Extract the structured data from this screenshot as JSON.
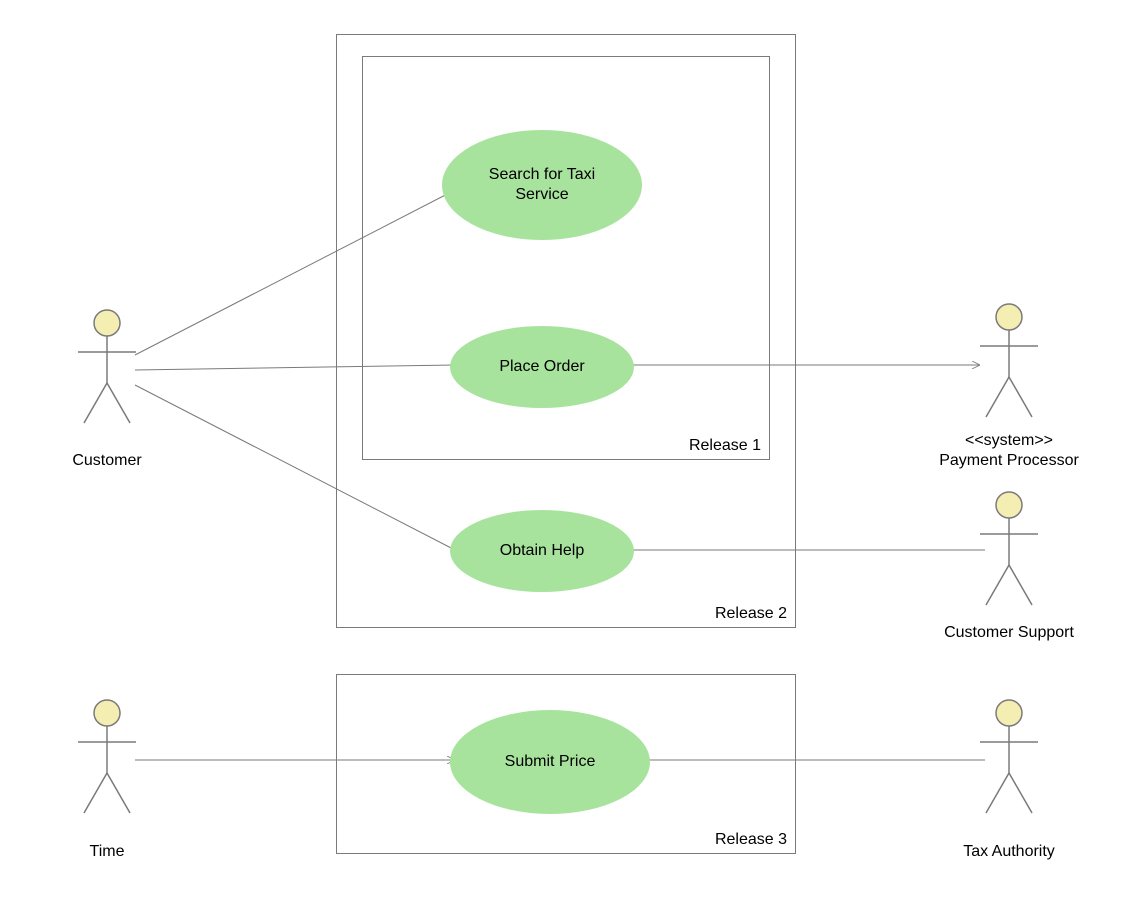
{
  "actors": {
    "customer": {
      "label": "Customer"
    },
    "time": {
      "label": "Time"
    },
    "paymentProcessor": {
      "stereotype": "<<system>>",
      "label": "Payment Processor"
    },
    "customerSupport": {
      "label": "Customer Support"
    },
    "taxAuthority": {
      "label": "Tax Authority"
    }
  },
  "boundaries": {
    "release1": {
      "label": "Release 1"
    },
    "release2": {
      "label": "Release 2"
    },
    "release3": {
      "label": "Release 3"
    }
  },
  "usecases": {
    "searchTaxi": {
      "label": "Search for Taxi Service"
    },
    "placeOrder": {
      "label": "Place Order"
    },
    "obtainHelp": {
      "label": "Obtain Help"
    },
    "submitPrice": {
      "label": "Submit Price"
    }
  }
}
